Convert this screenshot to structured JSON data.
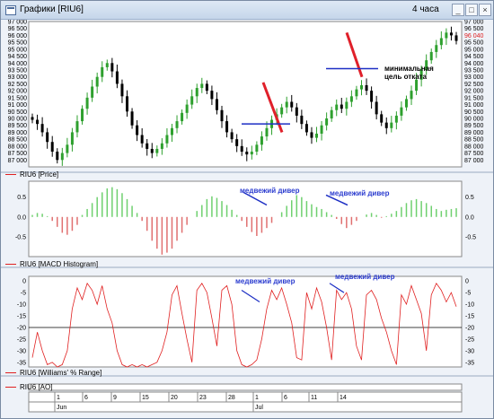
{
  "window": {
    "title": "Графики [RIU6]",
    "timeframe": "4 часа",
    "buttons": [
      "_",
      "□",
      "×"
    ]
  },
  "price_pane": {
    "label": "RIU6 [Price]",
    "y_ticks": [
      "97 000",
      "96 500",
      "96 000",
      "95 500",
      "95 000",
      "94 500",
      "94 000",
      "93 500",
      "93 000",
      "92 500",
      "92 000",
      "91 500",
      "91 000",
      "90 500",
      "90 000",
      "89 500",
      "89 000",
      "88 500",
      "88 000",
      "87 500",
      "87 000"
    ],
    "y_ticks_right": [
      "97 000",
      "96 500",
      "96 040",
      "95 500",
      "95 000",
      "94 500",
      "94 000",
      "93 500",
      "93 000",
      "92 500",
      "92 000",
      "91 500",
      "91 000",
      "90 500",
      "90 000",
      "89 500",
      "89 000",
      "88 500",
      "88 000",
      "87 500",
      "87 000"
    ],
    "last_price": "96 040",
    "annotation": "минимальная цель отката",
    "annotation_line1": "минимальная",
    "annotation_line2": "цель отката"
  },
  "macd_pane": {
    "label": "RIU6 [MACD Histogram]",
    "y_ticks": [
      "0.5",
      "0.0",
      "-0.5"
    ],
    "annotations": [
      "медвежий дивер",
      "медвежий дивер"
    ]
  },
  "williams_pane": {
    "label": "RIU6 [Williams' % Range]",
    "y_ticks": [
      "0",
      "-5",
      "-10",
      "-15",
      "-20",
      "-25",
      "-30",
      "-35"
    ],
    "annotations": [
      "медвежий дивер",
      "медвежий дивер"
    ]
  },
  "ao_pane": {
    "label": "RIU6 [AO]"
  },
  "time_axis": {
    "day_labels": [
      "1",
      "6",
      "9",
      "15",
      "20",
      "23",
      "28",
      "1",
      "6",
      "11",
      "14"
    ],
    "month_labels": [
      "Jun",
      "Jul"
    ]
  },
  "colors": {
    "up_candle": "#2ea02e",
    "down_candle": "#000000",
    "trend_line_red": "#e0202a",
    "support_line_blue": "#1d2fc4",
    "macd_positive": "#6fd06f",
    "macd_negative": "#e07070",
    "williams_line": "#e02020",
    "annotation_blue": "#2b3ccf"
  },
  "chart_data": [
    {
      "type": "candlestick",
      "ylim": [
        86500,
        97000
      ],
      "series": [
        {
          "values": [
            89900,
            89600,
            89000,
            88300,
            87600,
            87000,
            87500,
            88100,
            89000,
            89800,
            90700,
            91500,
            92300,
            93000,
            93700,
            94000,
            93400,
            92500,
            91600,
            90500,
            89500,
            88800,
            88200,
            87800,
            87500,
            87800,
            88200,
            88800,
            89300,
            89800,
            90400,
            91000,
            91600,
            92200,
            92500,
            92000,
            91400,
            90600,
            89800,
            89000,
            88500,
            88000,
            87600,
            87400,
            87600,
            88100,
            88700,
            89300,
            89900,
            90300,
            90800,
            91200,
            90800,
            90200,
            89600,
            89000,
            88600,
            88900,
            89500,
            90000,
            90600,
            91000,
            90700,
            91200,
            91600,
            92100,
            92400,
            92000,
            91200,
            90300,
            89700,
            89300,
            89700,
            90200,
            90800,
            91400,
            92000,
            92800,
            93500,
            94200,
            94800,
            95300,
            95800,
            96200,
            96000,
            95600
          ]
        }
      ]
    },
    {
      "type": "bar",
      "ylim": [
        -1.0,
        0.9
      ],
      "series": [
        {
          "values": [
            0.05,
            0.1,
            0.08,
            0.02,
            -0.1,
            -0.25,
            -0.4,
            -0.45,
            -0.35,
            -0.2,
            0.05,
            0.2,
            0.35,
            0.5,
            0.62,
            0.72,
            0.75,
            0.7,
            0.6,
            0.45,
            0.28,
            0.1,
            -0.1,
            -0.35,
            -0.6,
            -0.8,
            -0.95,
            -0.9,
            -0.8,
            -0.6,
            -0.4,
            -0.2,
            0.0,
            0.15,
            0.3,
            0.45,
            0.52,
            0.48,
            0.4,
            0.3,
            0.18,
            0.05,
            -0.1,
            -0.25,
            -0.38,
            -0.48,
            -0.4,
            -0.28,
            -0.15,
            0.0,
            0.12,
            0.28,
            0.42,
            0.55,
            0.5,
            0.4,
            0.32,
            0.25,
            0.2,
            0.12,
            0.05,
            -0.05,
            -0.18,
            -0.28,
            -0.2,
            -0.1,
            0.0,
            0.06,
            0.1,
            0.05,
            -0.02,
            0.02,
            0.08,
            0.15,
            0.25,
            0.35,
            0.42,
            0.45,
            0.4,
            0.35,
            0.28,
            0.2,
            0.15,
            0.18,
            0.2,
            0.22
          ]
        }
      ]
    },
    {
      "type": "line",
      "ylim": [
        -37,
        2
      ],
      "series": [
        {
          "values": [
            -33,
            -22,
            -30,
            -36,
            -35,
            -37,
            -36,
            -30,
            -12,
            -3,
            -8,
            -1,
            -4,
            -10,
            -2,
            -12,
            -18,
            -30,
            -36,
            -37,
            -36,
            -37,
            -36,
            -37,
            -36,
            -35,
            -30,
            -22,
            -6,
            -2,
            -14,
            -25,
            -35,
            -4,
            -1,
            -5,
            -16,
            -28,
            -4,
            -2,
            -10,
            -30,
            -36,
            -37,
            -36,
            -34,
            -25,
            -12,
            -4,
            -8,
            -3,
            -10,
            -18,
            -33,
            -34,
            -5,
            -12,
            -3,
            -9,
            -20,
            -34,
            -4,
            -8,
            -5,
            -12,
            -28,
            -34,
            -6,
            -4,
            -8,
            -16,
            -22,
            -30,
            -36,
            -6,
            -10,
            -2,
            -8,
            -14,
            -30,
            -6,
            -1,
            -4,
            -9,
            -5,
            -11
          ]
        }
      ]
    }
  ]
}
